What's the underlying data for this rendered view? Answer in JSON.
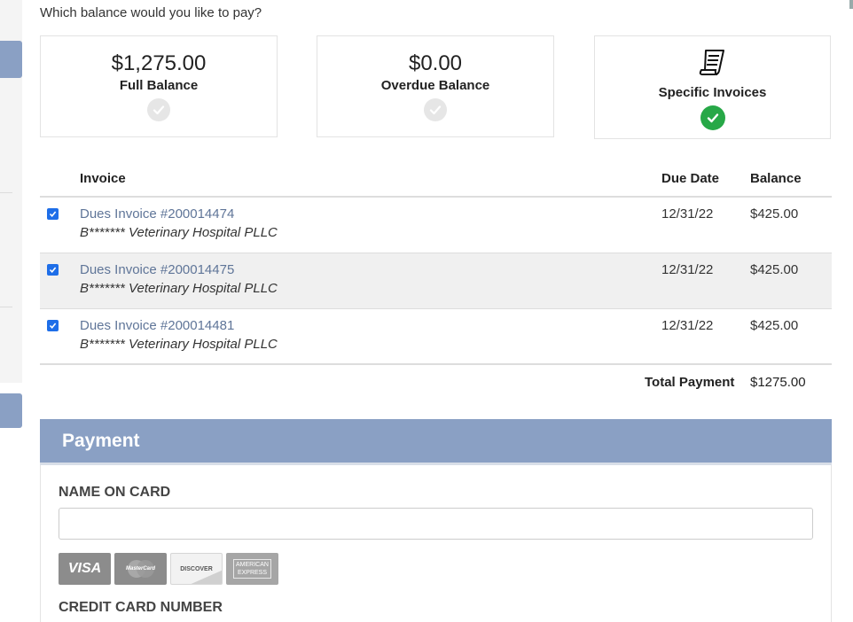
{
  "question": "Which balance would you like to pay?",
  "options": [
    {
      "amount": "$1,275.00",
      "label": "Full Balance",
      "selected": false
    },
    {
      "amount": "$0.00",
      "label": "Overdue Balance",
      "selected": false
    },
    {
      "icon": "invoice-document-icon",
      "label": "Specific Invoices",
      "selected": true
    }
  ],
  "table": {
    "headers": {
      "invoice": "Invoice",
      "due_date": "Due Date",
      "balance": "Balance"
    },
    "rows": [
      {
        "checked": true,
        "invoice": "Dues Invoice #200014474",
        "org": "B******* Veterinary Hospital PLLC",
        "due_date": "12/31/22",
        "balance": "$425.00"
      },
      {
        "checked": true,
        "invoice": "Dues Invoice #200014475",
        "org": "B******* Veterinary Hospital PLLC",
        "due_date": "12/31/22",
        "balance": "$425.00"
      },
      {
        "checked": true,
        "invoice": "Dues Invoice #200014481",
        "org": "B******* Veterinary Hospital PLLC",
        "due_date": "12/31/22",
        "balance": "$425.00"
      }
    ],
    "total_label": "Total Payment",
    "total_value": "$1275.00"
  },
  "payment": {
    "title": "Payment",
    "name_label": "NAME ON CARD",
    "name_value": "",
    "card_number_label": "CREDIT CARD NUMBER",
    "cards": {
      "visa": "VISA",
      "mastercard": "MasterCard",
      "discover": "DISCOVER",
      "amex_line1": "AMERICAN",
      "amex_line2": "EXPRESS"
    }
  },
  "colors": {
    "accent": "#8aa0c4",
    "link": "#5f7598",
    "success": "#27a847",
    "checkbox": "#1e6ee8"
  }
}
